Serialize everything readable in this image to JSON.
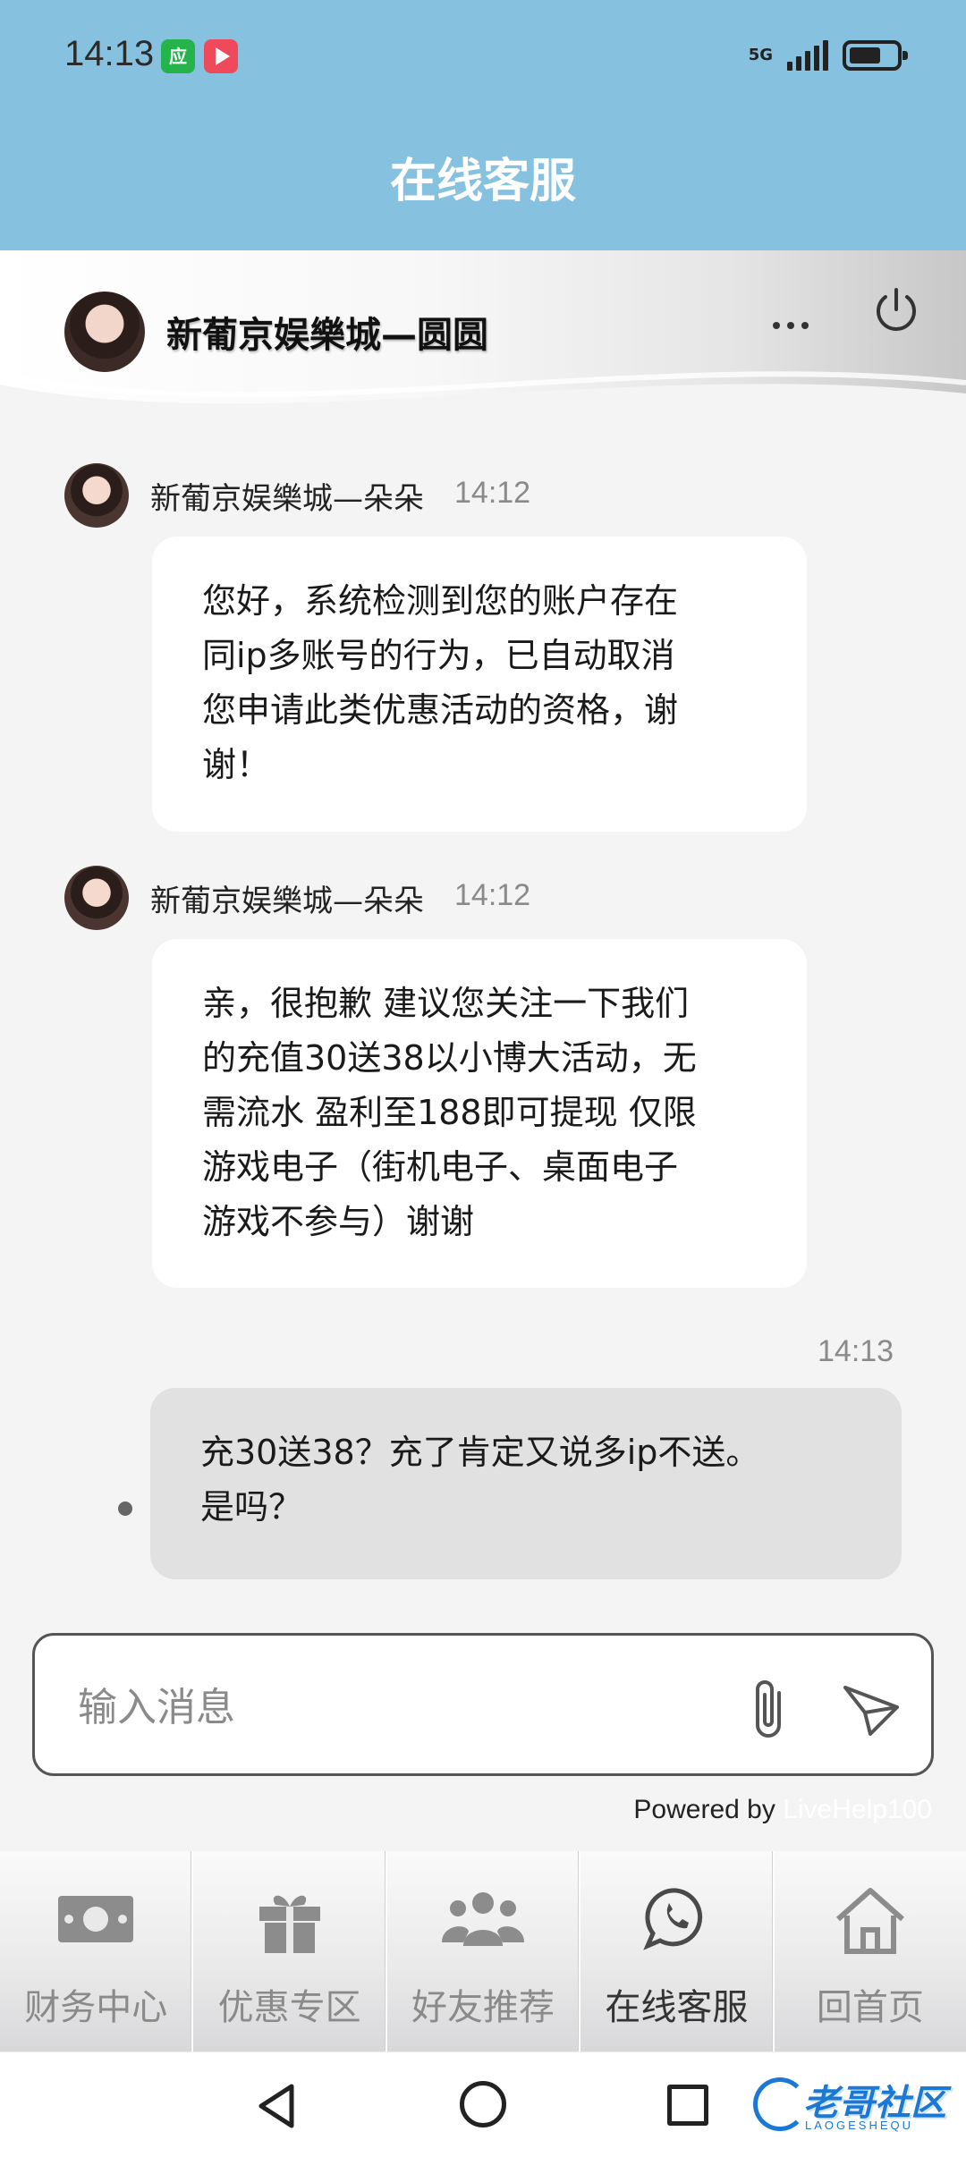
{
  "status": {
    "time": "14:13",
    "network": "5G",
    "app_badge": "应"
  },
  "header": {
    "title": "在线客服"
  },
  "agent": {
    "name": "新葡京娱樂城—圆圆"
  },
  "messages": [
    {
      "sender": "新葡京娱樂城—朵朵",
      "time": "14:12",
      "lines": [
        "您好，系统检测到您的账户存在",
        "同ip多账号的行为，已自动取消",
        "您申请此类优惠活动的资格，谢",
        "谢！"
      ]
    },
    {
      "sender": "新葡京娱樂城—朵朵",
      "time": "14:12",
      "lines": [
        "亲，很抱歉 建议您关注一下我们",
        "的充值30送38以小博大活动，无",
        "需流水 盈利至188即可提现 仅限",
        "游戏电子（街机电子、桌面电子",
        "游戏不参与）谢谢"
      ]
    },
    {
      "time": "14:13",
      "lines": [
        "充30送38？充了肯定又说多ip不送。",
        "是吗？"
      ]
    }
  ],
  "input": {
    "placeholder": "输入消息",
    "value": ""
  },
  "footer": {
    "powered_by": "Powered by",
    "brand": "LiveHelp100"
  },
  "tabs": [
    {
      "label": "财务中心",
      "icon": "money-icon"
    },
    {
      "label": "优惠专区",
      "icon": "gift-icon"
    },
    {
      "label": "好友推荐",
      "icon": "users-icon"
    },
    {
      "label": "在线客服",
      "icon": "whatsapp-icon",
      "active": true
    },
    {
      "label": "回首页",
      "icon": "home-icon"
    }
  ],
  "watermark": {
    "text": "老哥社区",
    "sub": "LAOGESHEQU"
  },
  "colors": {
    "header": "#86c1df",
    "tab_active": "#333333",
    "tab_inactive": "#8a8a8a",
    "user_bubble": "#e1e1e2"
  }
}
